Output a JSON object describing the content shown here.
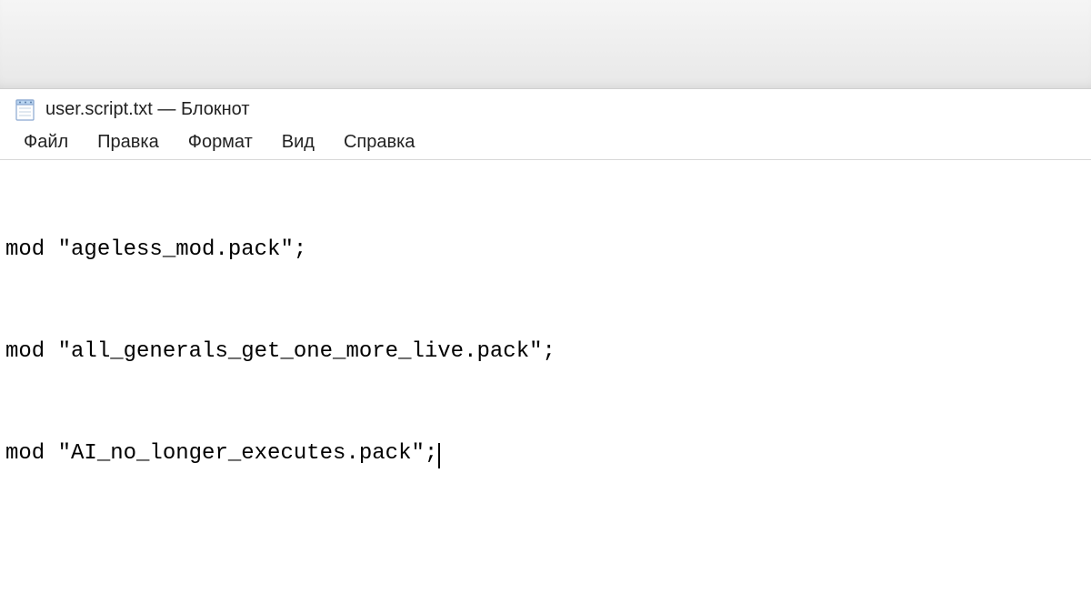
{
  "window": {
    "filename": "user.script.txt",
    "appname": "Блокнот",
    "title_separator": " — "
  },
  "menu": {
    "file": "Файл",
    "edit": "Правка",
    "format": "Формат",
    "view": "Вид",
    "help": "Справка"
  },
  "content": {
    "lines": [
      "mod \"ageless_mod.pack\";",
      "mod \"all_generals_get_one_more_live.pack\";",
      "mod \"AI_no_longer_executes.pack\";"
    ]
  }
}
